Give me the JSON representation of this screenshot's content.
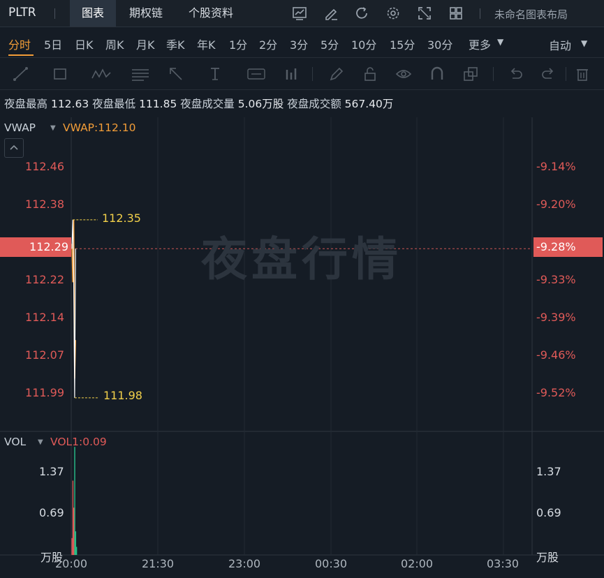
{
  "topbar": {
    "ticker": "PLTR",
    "tabs": [
      {
        "label": "图表",
        "active": true
      },
      {
        "label": "期权链",
        "active": false
      },
      {
        "label": "个股资料",
        "active": false
      }
    ],
    "icons": [
      "indicator-chart-icon",
      "draw-edit-icon",
      "refresh-icon",
      "settings-gear-icon",
      "fullscreen-icon",
      "grid-layout-icon"
    ],
    "layout_name": "未命名图表布局"
  },
  "periods": {
    "items": [
      "分时",
      "5日",
      "日K",
      "周K",
      "月K",
      "季K",
      "年K",
      "1分",
      "2分",
      "3分",
      "5分",
      "10分",
      "15分",
      "30分",
      "更多"
    ],
    "active": "分时",
    "more_caret": "▼",
    "scale_mode": "自动",
    "scale_caret": "▼"
  },
  "drawing_tools": [
    "trend-line-icon",
    "rectangle-icon",
    "pattern-icon",
    "fibonacci-icon",
    "arrow-icon",
    "text-tool-icon",
    "price-label-icon",
    "bar-pattern-icon",
    "pencil-icon",
    "lock-icon",
    "eye-icon",
    "magnet-icon",
    "layers-icon",
    "undo-icon",
    "redo-icon",
    "trash-icon"
  ],
  "stats": {
    "high_label": "夜盘最高",
    "high": "112.63",
    "low_label": "夜盘最低",
    "low": "111.85",
    "volume_label": "夜盘成交量",
    "volume": "5.06万股",
    "turnover_label": "夜盘成交额",
    "turnover": "567.40万"
  },
  "main_chart": {
    "indicator": "VWAP",
    "indicator_value": "VWAP:112.10",
    "watermark": "夜盘行情",
    "price_ticks": [
      "112.46",
      "112.38",
      "112.29",
      "112.22",
      "112.14",
      "112.07",
      "111.99"
    ],
    "current_price": "112.29",
    "current_change": "-9.28%",
    "pct_ticks": [
      "-9.14%",
      "-9.20%",
      "-9.28%",
      "-9.33%",
      "-9.39%",
      "-9.46%",
      "-9.52%"
    ],
    "high_annotation": "112.35",
    "low_annotation": "111.98",
    "colors": {
      "price_line": "#ffffff",
      "vwap_line": "#f29d38",
      "down": "#e05a58",
      "up": "#28c08a",
      "annotation": "#f2d04a"
    }
  },
  "volume_chart": {
    "indicator": "VOL",
    "indicator_value": "VOL1:0.09",
    "ticks_left": [
      "1.37",
      "0.69",
      "万股"
    ],
    "ticks_right": [
      "1.37",
      "0.69",
      "万股"
    ]
  },
  "time_axis": [
    "20:00",
    "21:30",
    "23:00",
    "00:30",
    "02:00",
    "03:30"
  ],
  "chart_data": {
    "type": "line",
    "title": "",
    "time_axis_labels": [
      "20:00",
      "21:30",
      "23:00",
      "00:30",
      "02:00",
      "03:30"
    ],
    "y_ticks": [
      112.46,
      112.38,
      112.29,
      112.22,
      112.14,
      112.07,
      111.99
    ],
    "ylim": [
      111.95,
      112.5
    ],
    "series": [
      {
        "name": "VWAP",
        "x": [
          "20:00",
          "20:01",
          "20:02",
          "20:03",
          "20:04"
        ],
        "values": [
          112.3,
          112.22,
          112.35,
          112.02,
          112.1
        ]
      },
      {
        "values": [
          112.29,
          112.35,
          112.22,
          111.98,
          112.29
        ]
      }
    ],
    "volume": {
      "ylim": [
        0,
        1.55
      ],
      "unit": "万股",
      "bars": [
        {
          "x": "20:00",
          "value": 0.25,
          "dir": "down"
        },
        {
          "x": "20:01",
          "value": 1.1,
          "dir": "down"
        },
        {
          "x": "20:02",
          "value": 0.7,
          "dir": "down"
        },
        {
          "x": "20:03",
          "value": 1.6,
          "dir": "up"
        },
        {
          "x": "20:04",
          "value": 0.35,
          "dir": "up"
        },
        {
          "x": "20:05",
          "value": 0.12,
          "dir": "up"
        }
      ]
    },
    "grid": true
  }
}
